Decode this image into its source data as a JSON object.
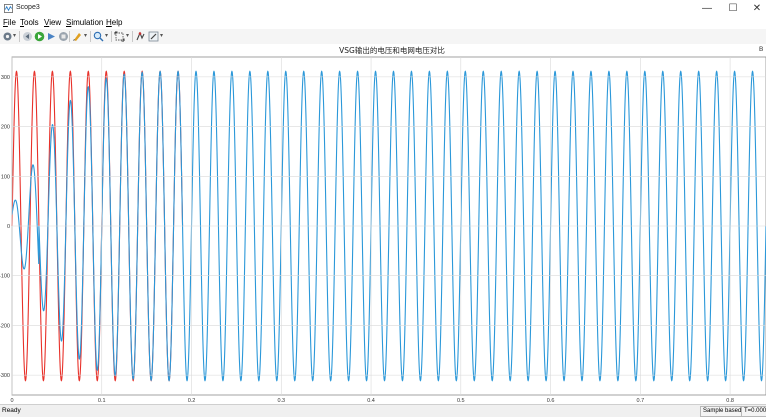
{
  "window": {
    "title": "Scope3"
  },
  "window_controls": {
    "minimize": "—",
    "maximize": "☐",
    "close": "✕"
  },
  "menu": [
    {
      "label": "File",
      "mn": "F",
      "rest": "ile"
    },
    {
      "label": "Tools",
      "mn": "T",
      "rest": "ools"
    },
    {
      "label": "View",
      "mn": "V",
      "rest": "iew"
    },
    {
      "label": "Simulation",
      "mn": "S",
      "rest": "imulation"
    },
    {
      "label": "Help",
      "mn": "H",
      "rest": "elp"
    }
  ],
  "toolbar": {
    "icons": [
      "settings-gear-icon",
      "step-back-icon",
      "run-icon",
      "step-forward-icon",
      "stop-icon",
      "highlight-pen-icon",
      "zoom-icon",
      "fit-axes-icon",
      "data-cursor-icon",
      "style-edit-icon"
    ],
    "caret": "▾"
  },
  "plot": {
    "title": "VSG输出的电压和电网电压对比",
    "corner_label": "B",
    "ylim": [
      -340,
      340
    ],
    "xlim": [
      0,
      0.84
    ],
    "yticks": [
      300,
      200,
      100,
      0,
      -100,
      -200,
      -300
    ],
    "xticks": [
      0,
      0.1,
      0.2,
      0.3,
      0.4,
      0.5,
      0.6,
      0.7,
      0.8
    ],
    "ytick_labels": [
      "300",
      "200",
      "100",
      "0",
      "-100",
      "-200",
      "-300"
    ],
    "xtick_labels": [
      "0",
      "0.1",
      "0.2",
      "0.3",
      "0.4",
      "0.5",
      "0.6",
      "0.7",
      "0.8"
    ],
    "grid": true
  },
  "chart_data": {
    "type": "line",
    "title": "VSG输出的电压和电网电压对比",
    "xlabel": "",
    "ylabel": "",
    "xlim": [
      0,
      0.84
    ],
    "ylim": [
      -340,
      340
    ],
    "grid": true,
    "series": [
      {
        "color": "#e8312a",
        "frequency_hz": 50,
        "amplitude": 311,
        "x_range": [
          0,
          0.19
        ]
      },
      {
        "color": "#2b98d9",
        "frequency_hz": 50,
        "amplitude": 311,
        "x_range": [
          0,
          0.84
        ],
        "startup_envelope": [
          [
            0,
            40
          ],
          [
            0.02,
            110
          ],
          [
            0.04,
            190
          ],
          [
            0.06,
            245
          ],
          [
            0.08,
            275
          ],
          [
            0.1,
            295
          ],
          [
            0.13,
            307
          ],
          [
            0.16,
            311
          ]
        ]
      }
    ]
  },
  "status": {
    "left": "Ready",
    "mode": "Sample based",
    "time": "T=0.000"
  }
}
